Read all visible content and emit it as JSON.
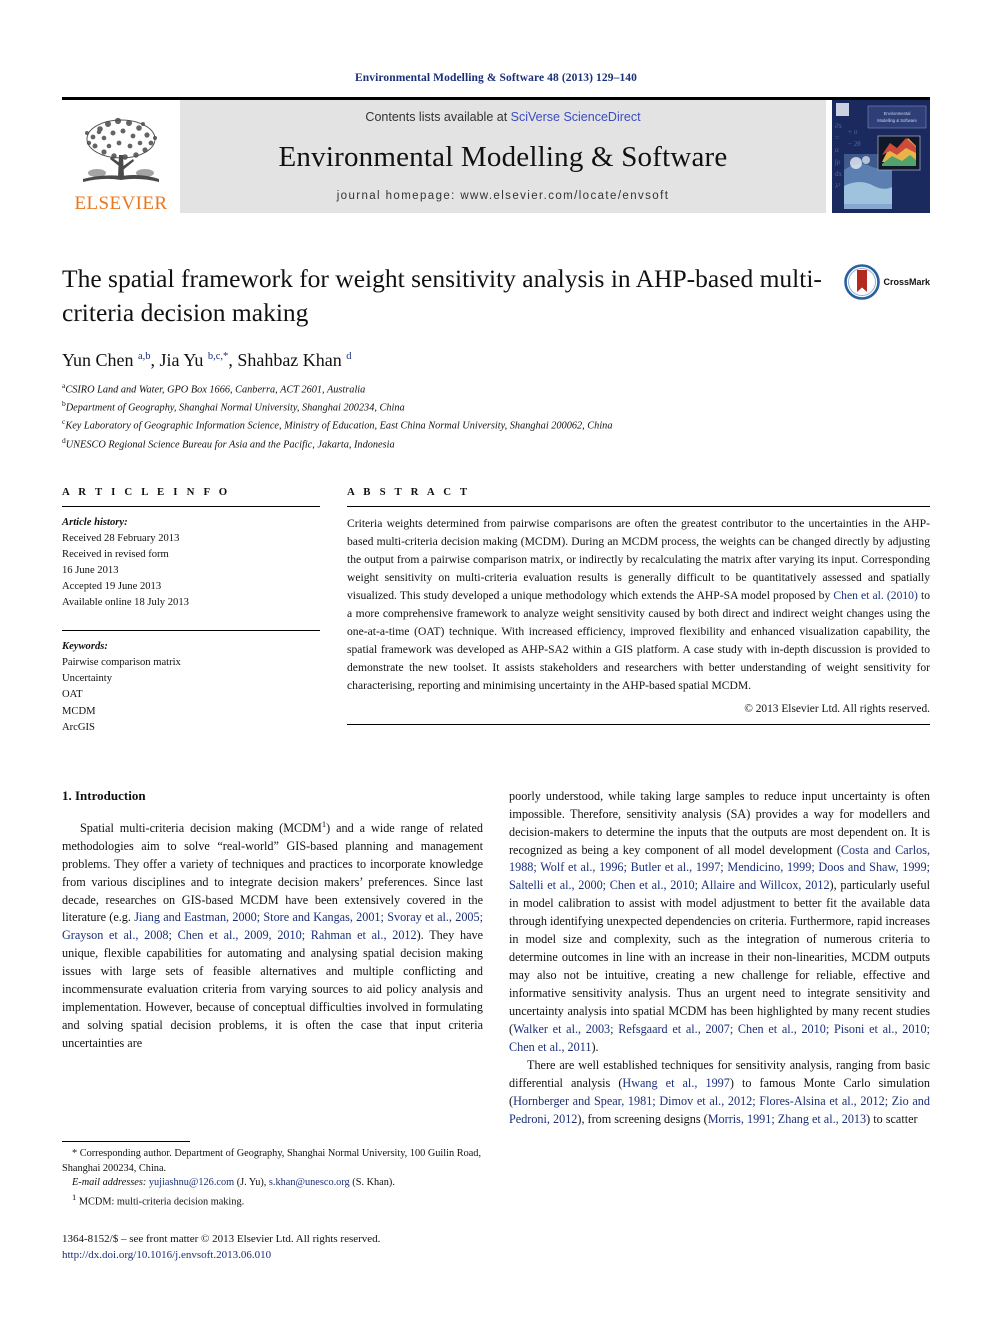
{
  "running_head": "Environmental Modelling & Software 48 (2013) 129–140",
  "masthead": {
    "contents_prefix": "Contents lists available at ",
    "sciencedirect": "SciVerse ScienceDirect",
    "journal_title": "Environmental Modelling & Software",
    "homepage": "journal homepage: www.elsevier.com/locate/envsoft",
    "publisher": "ELSEVIER",
    "cover_title": "Environmental Modelling & Software"
  },
  "article": {
    "title": "The spatial framework for weight sensitivity analysis in AHP-based multi-criteria decision making",
    "crossmark_label": "CrossMark",
    "authors_html": "Yun Chen <sup>a,b</sup>, Jia Yu <sup>b,c,*</sup>, Shahbaz Khan <sup>d</sup>",
    "affiliations": [
      {
        "sup": "a",
        "text": "CSIRO Land and Water, GPO Box 1666, Canberra, ACT 2601, Australia"
      },
      {
        "sup": "b",
        "text": "Department of Geography, Shanghai Normal University, Shanghai 200234, China"
      },
      {
        "sup": "c",
        "text": "Key Laboratory of Geographic Information Science, Ministry of Education, East China Normal University, Shanghai 200062, China"
      },
      {
        "sup": "d",
        "text": "UNESCO Regional Science Bureau for Asia and the Pacific, Jakarta, Indonesia"
      }
    ]
  },
  "article_info": {
    "heading": "A R T I C L E   I N F O",
    "history_label": "Article history:",
    "history": [
      "Received 28 February 2013",
      "Received in revised form",
      "16 June 2013",
      "Accepted 19 June 2013",
      "Available online 18 July 2013"
    ],
    "keywords_label": "Keywords:",
    "keywords": [
      "Pairwise comparison matrix",
      "Uncertainty",
      "OAT",
      "MCDM",
      "ArcGIS"
    ]
  },
  "abstract": {
    "heading": "A B S T R A C T",
    "part1": "Criteria weights determined from pairwise comparisons are often the greatest contributor to the uncertainties in the AHP-based multi-criteria decision making (MCDM). During an MCDM process, the weights can be changed directly by adjusting the output from a pairwise comparison matrix, or indirectly by recalculating the matrix after varying its input. Corresponding weight sensitivity on multi-criteria evaluation results is generally difficult to be quantitatively assessed and spatially visualized. This study developed a unique methodology which extends the AHP-SA model proposed by ",
    "ref1": "Chen et al. (2010)",
    "part2": " to a more comprehensive framework to analyze weight sensitivity caused by both direct and indirect weight changes using the one-at-a-time (OAT) technique. With increased efficiency, improved flexibility and enhanced visualization capability, the spatial framework was developed as AHP-SA2 within a GIS platform. A case study with in-depth discussion is provided to demonstrate the new toolset. It assists stakeholders and researchers with better understanding of weight sensitivity for characterising, reporting and minimising uncertainty in the AHP-based spatial MCDM.",
    "copyright": "© 2013 Elsevier Ltd. All rights reserved."
  },
  "introduction": {
    "section_number_title": "1. Introduction",
    "left_p1_a": "Spatial multi-criteria decision making (MCDM",
    "left_p1_sup": "1",
    "left_p1_b": ") and a wide range of related methodologies aim to solve “real-world” GIS-based planning and management problems. They offer a variety of techniques and practices to incorporate knowledge from various disciplines and to integrate decision makers’ preferences. Since last decade, researches on GIS-based MCDM have been extensively covered in the literature (e.g. ",
    "left_p1_refs": "Jiang and Eastman, 2000; Store and Kangas, 2001; Svoray et al., 2005; Grayson et al., 2008; Chen et al., 2009, 2010; Rahman et al., 2012",
    "left_p1_c": "). They have unique, flexible capabilities for automating and analysing spatial decision making issues with large sets of feasible alternatives and multiple conflicting and incommensurate evaluation criteria from varying sources to aid policy analysis and implementation. However, because of conceptual difficulties involved in formulating and solving spatial decision problems, it is often the case that input criteria uncertainties are",
    "right_p1_a": "poorly understood, while taking large samples to reduce input uncertainty is often impossible. Therefore, sensitivity analysis (SA) provides a way for modellers and decision-makers to determine the inputs that the outputs are most dependent on. It is recognized as being a key component of all model development (",
    "right_p1_refs": "Costa and Carlos, 1988; Wolf et al., 1996; Butler et al., 1997; Mendicino, 1999; Doos and Shaw, 1999; Saltelli et al., 2000; Chen et al., 2010; Allaire and Willcox, 2012",
    "right_p1_b": "), particularly useful in model calibration to assist with model adjustment to better fit the available data through identifying unexpected dependencies on criteria. Furthermore, rapid increases in model size and complexity, such as the integration of numerous criteria to determine outcomes in line with an increase in their non-linearities, MCDM outputs may also not be intuitive, creating a new challenge for reliable, effective and informative sensitivity analysis. Thus an urgent need to integrate sensitivity and uncertainty analysis into spatial MCDM has been highlighted by many recent studies (",
    "right_p1_refs2": "Walker et al., 2003; Refsgaard et al., 2007; Chen et al., 2010; Pisoni et al., 2010; Chen et al., 2011",
    "right_p1_c": ").",
    "right_p2_a": "There are well established techniques for sensitivity analysis, ranging from basic differential analysis (",
    "right_p2_ref1": "Hwang et al., 1997",
    "right_p2_b": ") to famous Monte Carlo simulation (",
    "right_p2_ref2": "Hornberger and Spear, 1981; Dimov et al., 2012; Flores-Alsina et al., 2012; Zio and Pedroni, 2012",
    "right_p2_c": "), from screening designs (",
    "right_p2_ref3": "Morris, 1991; Zhang et al., 2013",
    "right_p2_d": ") to scatter"
  },
  "footnotes": {
    "corresponding": "* Corresponding author. Department of Geography, Shanghai Normal University, 100 Guilin Road, Shanghai 200234, China.",
    "email_label": "E-mail addresses:",
    "email1": "yujiashnu@126.com",
    "email1_owner": " (J. Yu), ",
    "email2": "s.khan@unesco.org",
    "email2_owner": " (S. Khan).",
    "note_sup": "1",
    "note_text": "MCDM: multi-criteria decision making."
  },
  "imprint": {
    "line1": "1364-8152/$ – see front matter © 2013 Elsevier Ltd. All rights reserved.",
    "doi": "http://dx.doi.org/10.1016/j.envsoft.2013.06.010"
  },
  "colors": {
    "link_blue": "#1a2f7a",
    "sciencedirect_blue": "#3b4cc0",
    "elsevier_orange": "#E87722",
    "masthead_grey": "#e3e3e3",
    "cover_navy": "#1b2a5e",
    "crossmark_red": "#b5291f"
  }
}
